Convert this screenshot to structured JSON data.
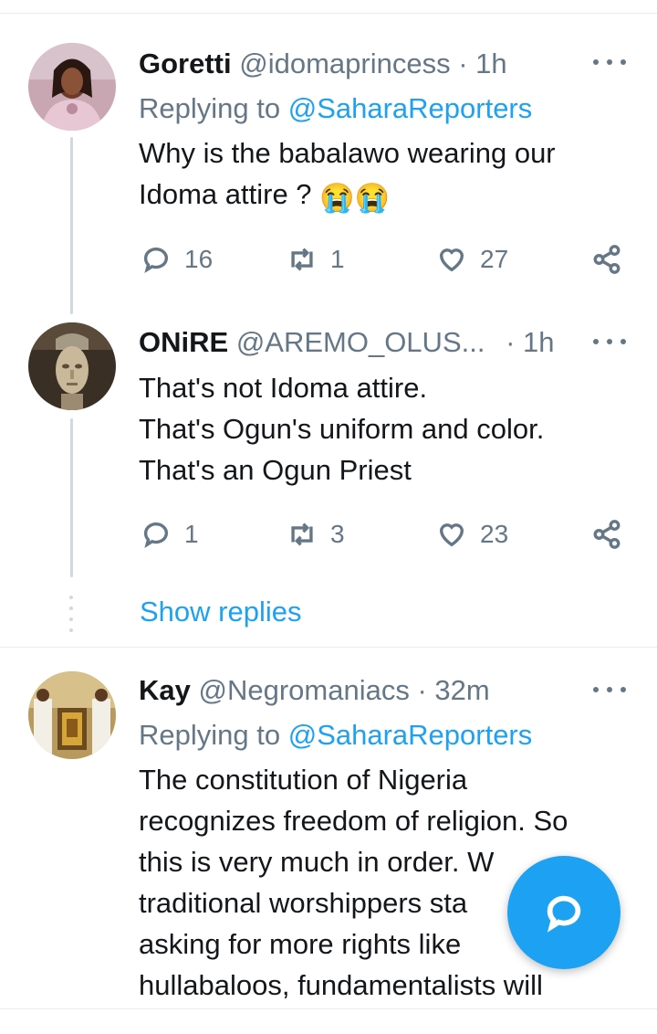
{
  "tweets": [
    {
      "name": "Goretti",
      "handle": "@idomaprincess",
      "time": "· 1h",
      "replying_prefix": "Replying to ",
      "replying_to": "@SaharaReporters",
      "text": "Why is the babalawo wearing our\nIdoma attire ?",
      "emoji": "😭😭",
      "replies": "16",
      "retweets": "1",
      "likes": "27"
    },
    {
      "name": "ONiRE",
      "handle": "@AREMO_OLUS...",
      "time": "· 1h",
      "text": "That's not Idoma attire.\nThat's Ogun's uniform and color.\nThat's an Ogun Priest",
      "replies": "1",
      "retweets": "3",
      "likes": "23"
    },
    {
      "name": "Kay",
      "handle": "@Negromaniacs",
      "time": "· 32m",
      "replying_prefix": "Replying to ",
      "replying_to": "@SaharaReporters",
      "text": "The constitution of Nigeria\nrecognizes freedom of religion. So\nthis is very much in order. W\ntraditional worshippers sta\nasking for more rights like\nhullabaloos, fundamentalists will"
    }
  ],
  "show_replies": "Show replies",
  "icons": {
    "reply": "reply-icon",
    "retweet": "retweet-icon",
    "like": "heart-icon",
    "share": "share-icon",
    "more": "more-icon",
    "compose": "compose-reply-icon"
  },
  "colors": {
    "accent": "#1da1f2",
    "secondary_text": "#657786",
    "divider": "#e6ecf0"
  }
}
